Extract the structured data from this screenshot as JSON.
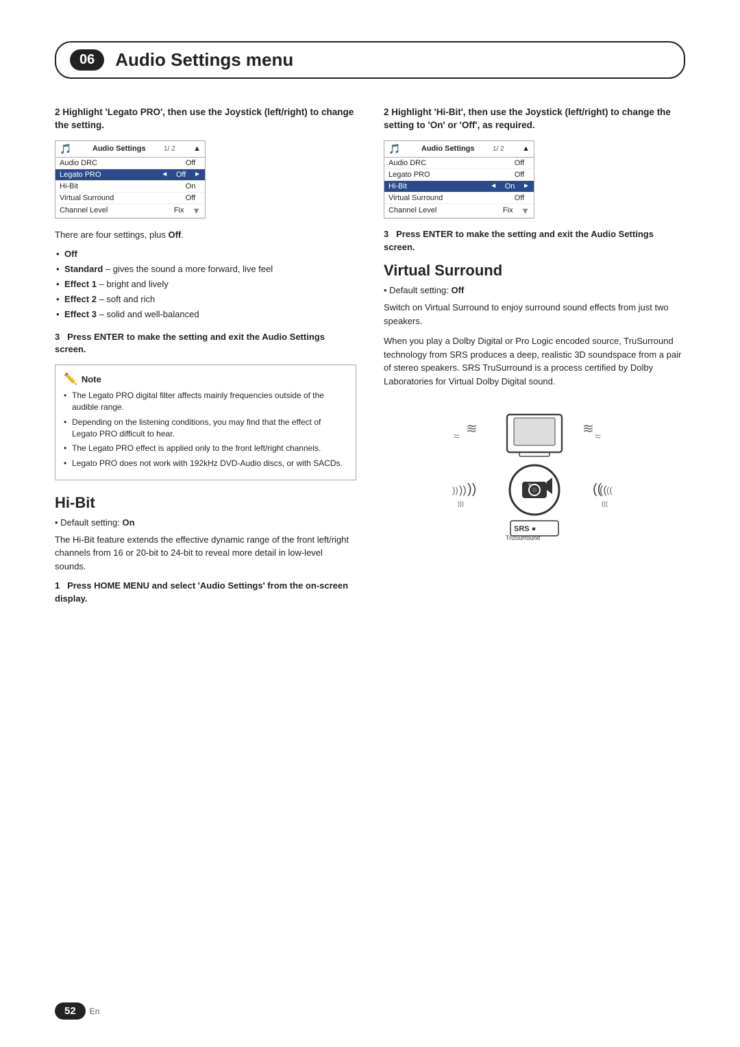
{
  "header": {
    "chapter_num": "06",
    "title": "Audio Settings menu"
  },
  "left_col": {
    "step2_heading": "2  Highlight 'Legato PRO', then use the Joystick (left/right) to change the setting.",
    "table1": {
      "title": "Audio Settings",
      "page": "1/ 2",
      "rows": [
        {
          "label": "Audio DRC",
          "value": "Off",
          "highlighted": false,
          "arrow_left": false,
          "arrow_right": false,
          "scroll": "top"
        },
        {
          "label": "Legato PRO",
          "value": "Off",
          "highlighted": true,
          "arrow_left": true,
          "arrow_right": true
        },
        {
          "label": "Hi-Bit",
          "value": "On",
          "highlighted": false
        },
        {
          "label": "Virtual Surround",
          "value": "Off",
          "highlighted": false
        },
        {
          "label": "Channel Level",
          "value": "Fix",
          "highlighted": false,
          "scroll": "bottom"
        }
      ]
    },
    "settings_intro": "There are four settings, plus",
    "settings_intro_bold": "Off",
    "bullet_items": [
      {
        "text": "Off"
      },
      {
        "text": "Standard – gives the sound a more forward, live feel"
      },
      {
        "text": "Effect 1 – bright and lively"
      },
      {
        "text": "Effect 2 – soft and rich"
      },
      {
        "text": "Effect 3 – solid and well-balanced"
      }
    ],
    "step3_heading": "3   Press ENTER to make the setting and exit the Audio Settings screen.",
    "note_label": "Note",
    "note_items": [
      "The Legato PRO digital filter affects mainly frequencies outside of the audible range.",
      "Depending on the listening conditions, you may find that the effect of Legato PRO difficult to hear.",
      "The Legato PRO effect is applied only to the front left/right channels.",
      "Legato PRO does not work with 192kHz DVD-Audio discs, or with SACDs."
    ],
    "hibit_heading": "Hi-Bit",
    "hibit_default": "Default setting: On",
    "hibit_body": "The Hi-Bit feature extends the effective dynamic range of the front left/right channels from 16 or 20-bit to 24-bit to reveal more detail in low-level sounds.",
    "hibit_step1": "1   Press HOME MENU and select 'Audio Settings' from the on-screen display."
  },
  "right_col": {
    "step2_heading": "2  Highlight 'Hi-Bit', then use the Joystick (left/right) to change the setting to 'On' or 'Off', as required.",
    "table2": {
      "title": "Audio Settings",
      "page": "1/ 2",
      "rows": [
        {
          "label": "Audio DRC",
          "value": "Off",
          "highlighted": false,
          "scroll": "top"
        },
        {
          "label": "Legato PRO",
          "value": "Off",
          "highlighted": false
        },
        {
          "label": "Hi-Bit",
          "value": "On",
          "highlighted": true,
          "arrow_left": true,
          "arrow_right": true
        },
        {
          "label": "Virtual Surround",
          "value": "Off",
          "highlighted": false
        },
        {
          "label": "Channel Level",
          "value": "Fix",
          "highlighted": false,
          "scroll": "bottom"
        }
      ]
    },
    "step3_heading": "3   Press ENTER to make the setting and exit the Audio Settings screen.",
    "virtual_surround_heading": "Virtual Surround",
    "virtual_surround_default": "Default setting: Off",
    "virtual_surround_body1": "Switch on Virtual Surround to enjoy surround sound effects from just two speakers.",
    "virtual_surround_body2": "When you play a Dolby Digital or Pro Logic encoded source, TruSurround technology from SRS produces a deep, realistic 3D soundspace from a pair of stereo speakers. SRS TruSurround is a process certified by Dolby Laboratories for Virtual Dolby Digital sound.",
    "srs_logo_text": "SRS●\nTruSurround"
  },
  "footer": {
    "page_num": "52",
    "lang": "En"
  }
}
